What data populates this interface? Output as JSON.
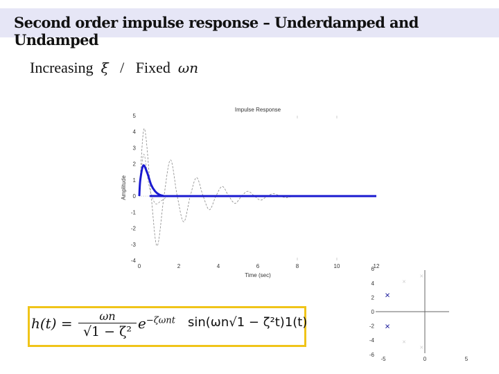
{
  "header": {
    "title": "Second order impulse response – Underdamped and Undamped"
  },
  "subtitle": {
    "prefix": "Increasing",
    "symbol1": "ξ",
    "separator": "/",
    "middle": "Fixed",
    "symbol2": "ωn"
  },
  "formula": {
    "lhs": "h(t) =",
    "numerator": "ωn",
    "denominator": "√1 − ζ²",
    "base": "e",
    "exponent": "−ζωnt",
    "rest": "sin(ωn√1 − ζ²t)1(t)",
    "border_color": "#f0c419"
  },
  "chart_data": [
    {
      "type": "line",
      "title": "Impulse Response",
      "xlabel": "Time (sec)",
      "ylabel": "Amplitude",
      "xlim": [
        0,
        12
      ],
      "ylim": [
        -4,
        5
      ],
      "xticks": [
        0,
        2,
        4,
        6,
        8,
        10,
        12
      ],
      "yticks": [
        -4,
        -3,
        -2,
        -1,
        0,
        1,
        2,
        3,
        4,
        5
      ],
      "grid": false,
      "series": [
        {
          "style": "dashed",
          "color": "#888888",
          "x": [
            0,
            0.25,
            0.6,
            0.9,
            1.25,
            1.58,
            1.92,
            2.25,
            2.58,
            2.9,
            3.23,
            3.55,
            3.88,
            4.2,
            4.53,
            4.85,
            5.18,
            5.5,
            5.83,
            6.15,
            6.48,
            6.8,
            7.13,
            7.45,
            7.78,
            8.1,
            12
          ],
          "y": [
            0,
            4.2,
            0,
            -3.1,
            0,
            2.25,
            0,
            -1.6,
            0,
            1.15,
            0,
            -0.85,
            0,
            0.6,
            0,
            -0.45,
            0,
            0.3,
            0,
            -0.25,
            0,
            0.15,
            0,
            -0.1,
            0,
            0,
            0
          ]
        },
        {
          "style": "dashed",
          "color": "#999999",
          "x": [
            0,
            0.22,
            0.5,
            0.8,
            1.1,
            1.5,
            2,
            12
          ],
          "y": [
            0,
            2.6,
            0.6,
            -0.45,
            -0.3,
            0,
            0,
            0
          ]
        },
        {
          "style": "solid",
          "color": "#1a1ad0",
          "x": [
            0,
            0.05,
            0.2,
            0.4,
            0.6,
            0.8,
            1.0,
            1.2,
            1.4,
            12
          ],
          "y": [
            0,
            1.0,
            1.9,
            1.45,
            0.7,
            0.3,
            0.1,
            0.02,
            0,
            0
          ]
        }
      ]
    },
    {
      "type": "scatter",
      "xticks": [
        -5,
        0,
        5
      ],
      "yticks": [
        6,
        4,
        2,
        0,
        -2,
        -4,
        -6
      ],
      "xlim": [
        -6,
        6
      ],
      "ylim": [
        -6,
        6
      ],
      "series": [
        {
          "marker": "x",
          "color": "#1a1a9a",
          "x": [
            -4.5,
            -4.5
          ],
          "y": [
            2.2,
            -2.2
          ]
        },
        {
          "marker": "x",
          "color": "#cccccc",
          "x": [
            -0.4,
            -2.5,
            -2.5,
            -0.4
          ],
          "y": [
            5,
            4.2,
            -4.2,
            -5
          ]
        }
      ]
    }
  ]
}
